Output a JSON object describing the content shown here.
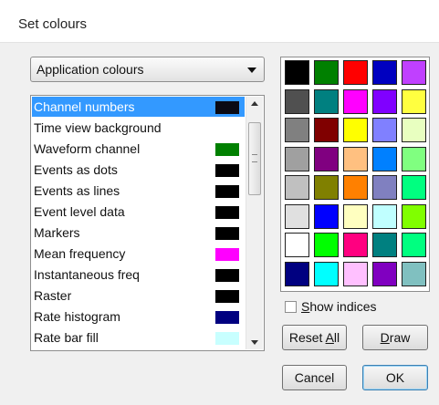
{
  "dialog": {
    "title": "Set colours"
  },
  "dropdown": {
    "selected": "Application colours"
  },
  "list": {
    "items": [
      {
        "label": "Channel numbers",
        "color": "#0a0a14",
        "selected": true
      },
      {
        "label": "Time view background",
        "color": ""
      },
      {
        "label": "Waveform channel",
        "color": "#008000"
      },
      {
        "label": "Events as dots",
        "color": "#000000"
      },
      {
        "label": "Events as lines",
        "color": "#000000"
      },
      {
        "label": "Event level data",
        "color": "#000000"
      },
      {
        "label": "Markers",
        "color": "#000000"
      },
      {
        "label": "Mean frequency",
        "color": "#ff00ff"
      },
      {
        "label": "Instantaneous freq",
        "color": "#000000"
      },
      {
        "label": "Raster",
        "color": "#000000"
      },
      {
        "label": "Rate histogram",
        "color": "#000080"
      },
      {
        "label": "Rate bar fill",
        "color": "#c8ffff"
      }
    ]
  },
  "palette": {
    "colors": [
      [
        "#000000",
        "#008000",
        "#ff0000",
        "#0000c0",
        "#c040ff"
      ],
      [
        "#505050",
        "#008080",
        "#ff00ff",
        "#8000ff",
        "#ffff40"
      ],
      [
        "#808080",
        "#800000",
        "#ffff00",
        "#8080ff",
        "#e8ffc0"
      ],
      [
        "#a0a0a0",
        "#800080",
        "#ffc080",
        "#0080ff",
        "#80ff80"
      ],
      [
        "#c0c0c0",
        "#808000",
        "#ff8000",
        "#8080c0",
        "#00ff80"
      ],
      [
        "#e0e0e0",
        "#0000ff",
        "#ffffc0",
        "#c0ffff",
        "#80ff00"
      ],
      [
        "#ffffff",
        "#00ff00",
        "#ff0080",
        "#008080",
        "#00ff80"
      ],
      [
        "#000080",
        "#00ffff",
        "#ffc0ff",
        "#8000c0",
        "#80c0c0"
      ]
    ]
  },
  "controls": {
    "show_indices_pre": "",
    "show_indices_accel": "S",
    "show_indices_post": "how indices",
    "show_indices_checked": false,
    "reset_all_pre": "Reset ",
    "reset_all_accel": "A",
    "reset_all_post": "ll",
    "draw_pre": "",
    "draw_accel": "D",
    "draw_post": "raw",
    "cancel_label": "Cancel",
    "ok_label": "OK"
  }
}
